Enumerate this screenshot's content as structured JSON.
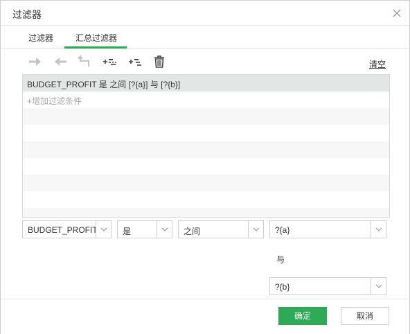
{
  "dialog": {
    "title": "过滤器",
    "close_icon": "close-icon"
  },
  "tabs": [
    {
      "label": "过滤器",
      "active": false
    },
    {
      "label": "汇总过滤器",
      "active": true
    }
  ],
  "accent_color": "#2eaa57",
  "toolbar": {
    "icons": [
      "arrow-right-icon",
      "arrow-left-icon",
      "corner-arrow-icon",
      "add-condition-icon",
      "add-group-icon",
      "trash-icon"
    ],
    "clear_label": "清空"
  },
  "conditions": {
    "rows": [
      {
        "text": "BUDGET_PROFIT 是 之间 [?{a}] 与 [?{b}]",
        "selected": true
      }
    ],
    "add_label": "+增加过滤条件"
  },
  "editor": {
    "field": "BUDGET_PROFIT",
    "operator": "是",
    "relation": "之间",
    "value1": "?{a}",
    "and_label": "与",
    "value2": "?{b}"
  },
  "footer": {
    "ok_label": "确定",
    "cancel_label": "取消"
  }
}
